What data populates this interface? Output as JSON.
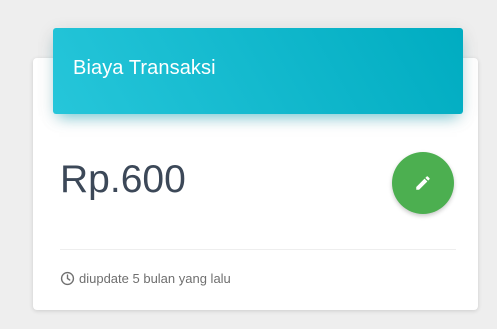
{
  "card": {
    "title": "Biaya Transaksi",
    "value": "Rp.600",
    "edit_icon": "pencil-icon",
    "footer_icon": "clock-icon",
    "footer_text": "diupdate 5 bulan yang lalu"
  },
  "colors": {
    "header_gradient_start": "#26c6da",
    "header_gradient_end": "#00acc1",
    "edit_button": "#4caf50",
    "value_text": "#3c4858"
  }
}
